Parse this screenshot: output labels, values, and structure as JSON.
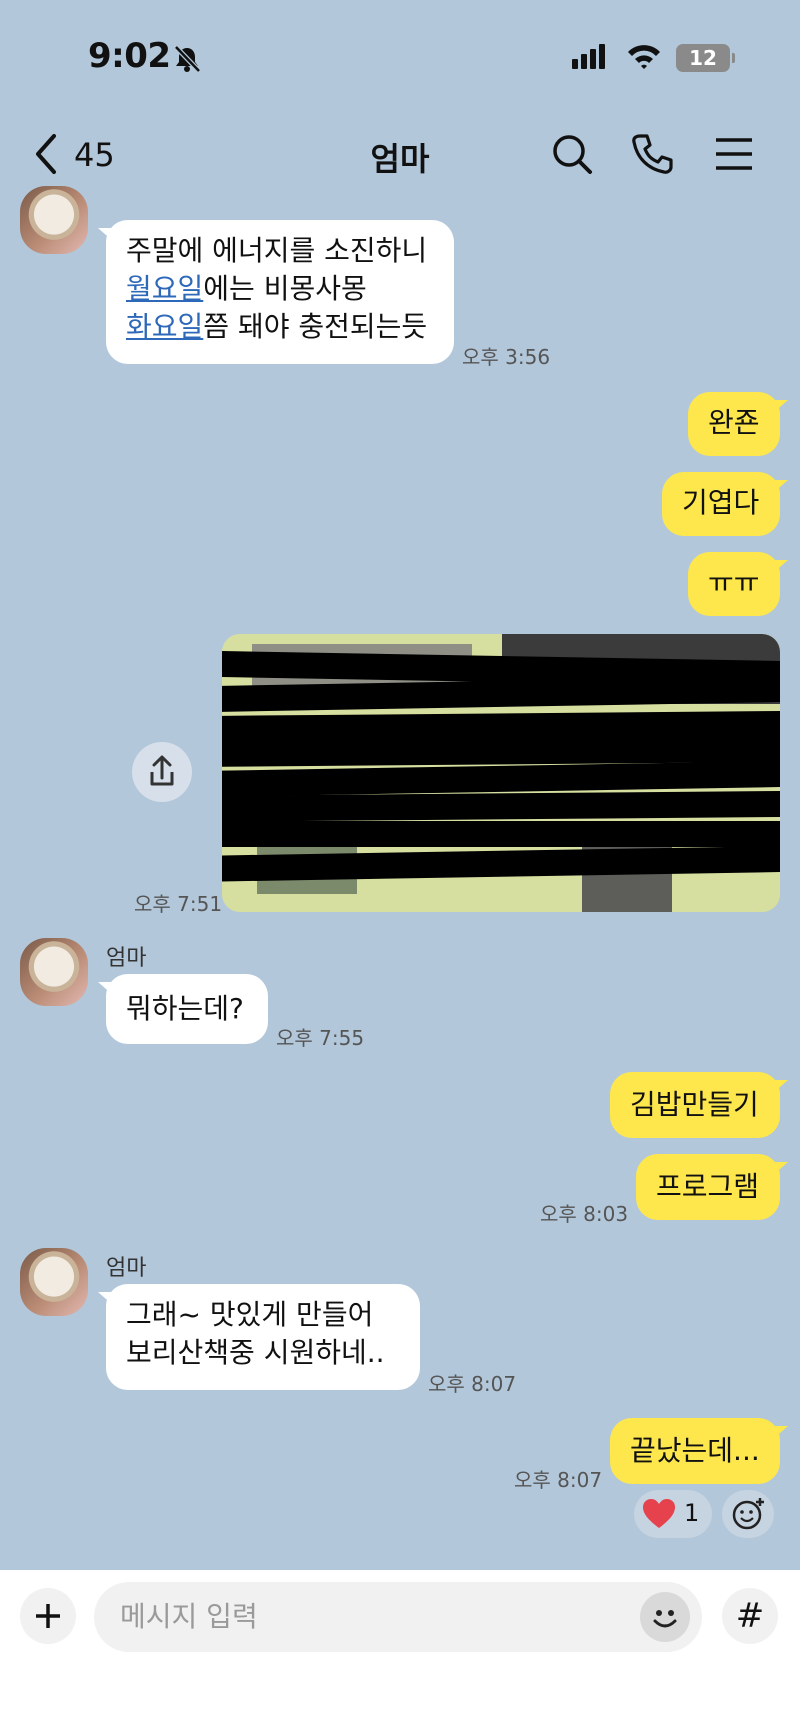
{
  "status_bar": {
    "time": "9:02",
    "battery": "12"
  },
  "header": {
    "unread_count": "45",
    "title": "엄마"
  },
  "messages": {
    "m1": {
      "sender": "엄마",
      "line1": "주말에 에너지를 소진하니",
      "line2_link": "월요일",
      "line2_rest": "에는 비몽사몽",
      "line3_link": "화요일",
      "line3_rest": "쯤 돼야 충전되는듯",
      "time": "오후 3:56"
    },
    "m2": {
      "text": "완죤"
    },
    "m3": {
      "text": "기엽다"
    },
    "m4": {
      "text": "ㅠㅠ"
    },
    "m5": {
      "time": "오후 7:51"
    },
    "m6": {
      "sender": "엄마",
      "text": "뭐하는데?",
      "time": "오후 7:55"
    },
    "m7": {
      "text": "김밥만들기"
    },
    "m8": {
      "text": "프로그램",
      "time": "오후 8:03"
    },
    "m9": {
      "sender": "엄마",
      "line1": "그래~ 맛있게 만들어",
      "line2": "보리산책중  시원하네..",
      "time": "오후 8:07"
    },
    "m10": {
      "text": "끝났는데...",
      "time": "오후 8:07",
      "reaction_count": "1"
    }
  },
  "composer": {
    "placeholder": "메시지 입력",
    "hash_label": "#"
  },
  "colors": {
    "background": "#b2c7da",
    "my_bubble": "#fde74c",
    "their_bubble": "#ffffff",
    "link": "#2e68b8",
    "heart": "#e5424d"
  }
}
